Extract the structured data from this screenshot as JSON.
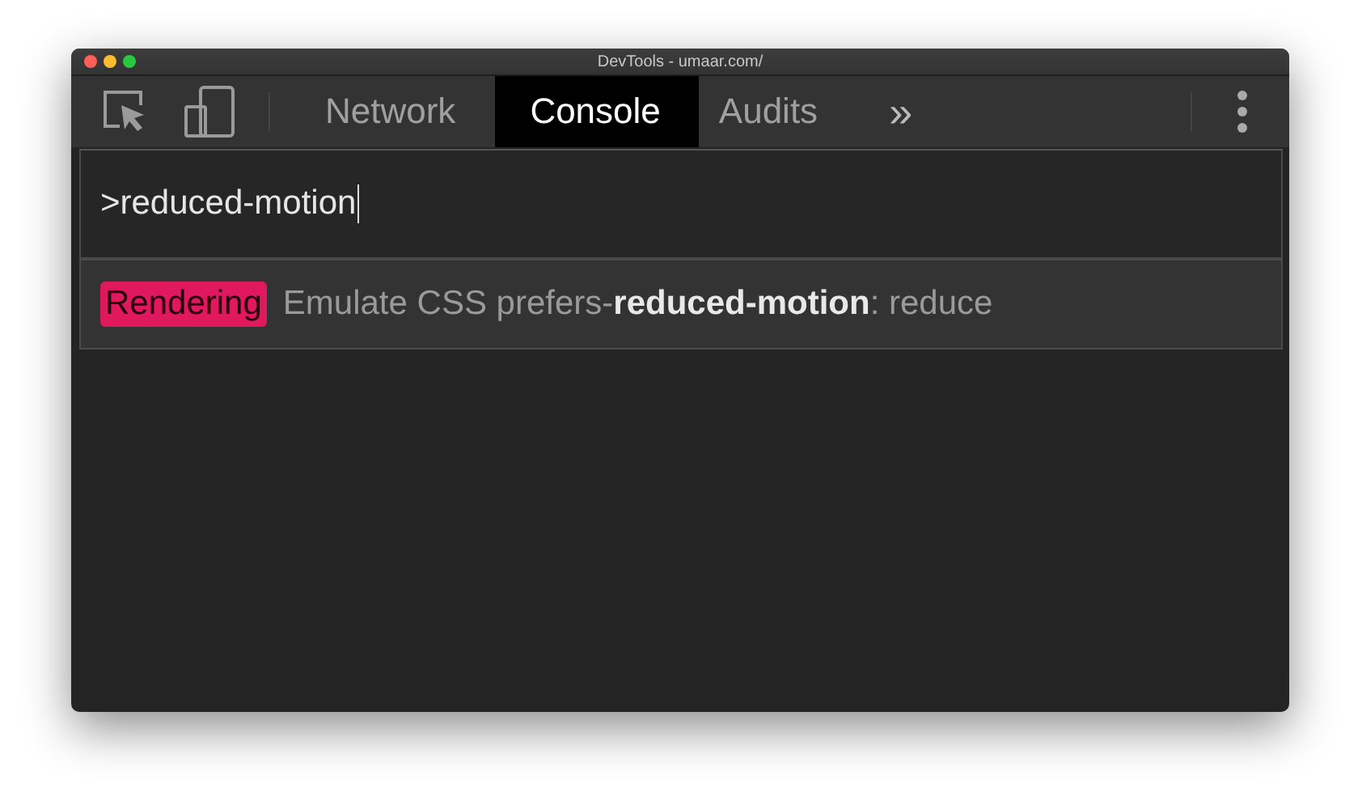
{
  "window": {
    "title": "DevTools - umaar.com/"
  },
  "toolbar": {
    "tabs": [
      {
        "label": "Network",
        "selected": false
      },
      {
        "label": "Console",
        "selected": true
      },
      {
        "label": "Audits",
        "selected": false
      }
    ],
    "overflow": "»"
  },
  "command_menu": {
    "query": ">reduced-motion",
    "results": [
      {
        "category": "Rendering",
        "color": "#e0185e",
        "text": "Emulate CSS prefers-**reduced-motion**: reduce",
        "selected": true
      }
    ]
  }
}
